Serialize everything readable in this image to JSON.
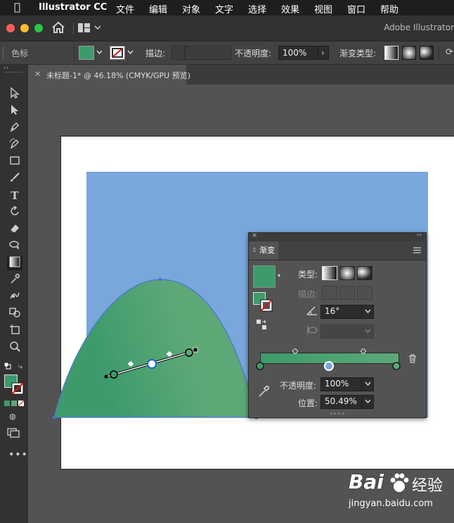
{
  "menubar": {
    "app_name": "Illustrator CC",
    "items": [
      "文件",
      "编辑",
      "对象",
      "文字",
      "选择",
      "效果",
      "视图",
      "窗口",
      "帮助"
    ]
  },
  "appbar": {
    "title": "Adobe Illustrator"
  },
  "control_bar": {
    "object_type": "色标",
    "stroke_label": "描边:",
    "opacity_label": "不透明度:",
    "opacity_value": "100%",
    "gradient_type_label": "渐变类型:"
  },
  "document_tab": {
    "close": "×",
    "title": "未标题-1* @ 46.18% (CMYK/GPU 预览)"
  },
  "gradient_panel": {
    "tab": "渐变",
    "type_label": "类型:",
    "stroke_label": "描边:",
    "angle_value": "16°",
    "opacity_label": "不透明度:",
    "opacity_value": "100%",
    "location_label": "位置:",
    "location_value": "50.49%",
    "gradient_start_color": "#3d9b6b",
    "gradient_end_color": "#5ea878",
    "midpoint_percent": 50.49
  },
  "colors": {
    "fill": "#3d9b6b",
    "rectangle": "#79a7db",
    "bezier_selection": "#4a72d8"
  },
  "watermark": {
    "brand": "Bai",
    "brand_cn": "经验",
    "url": "jingyan.baidu.com"
  }
}
